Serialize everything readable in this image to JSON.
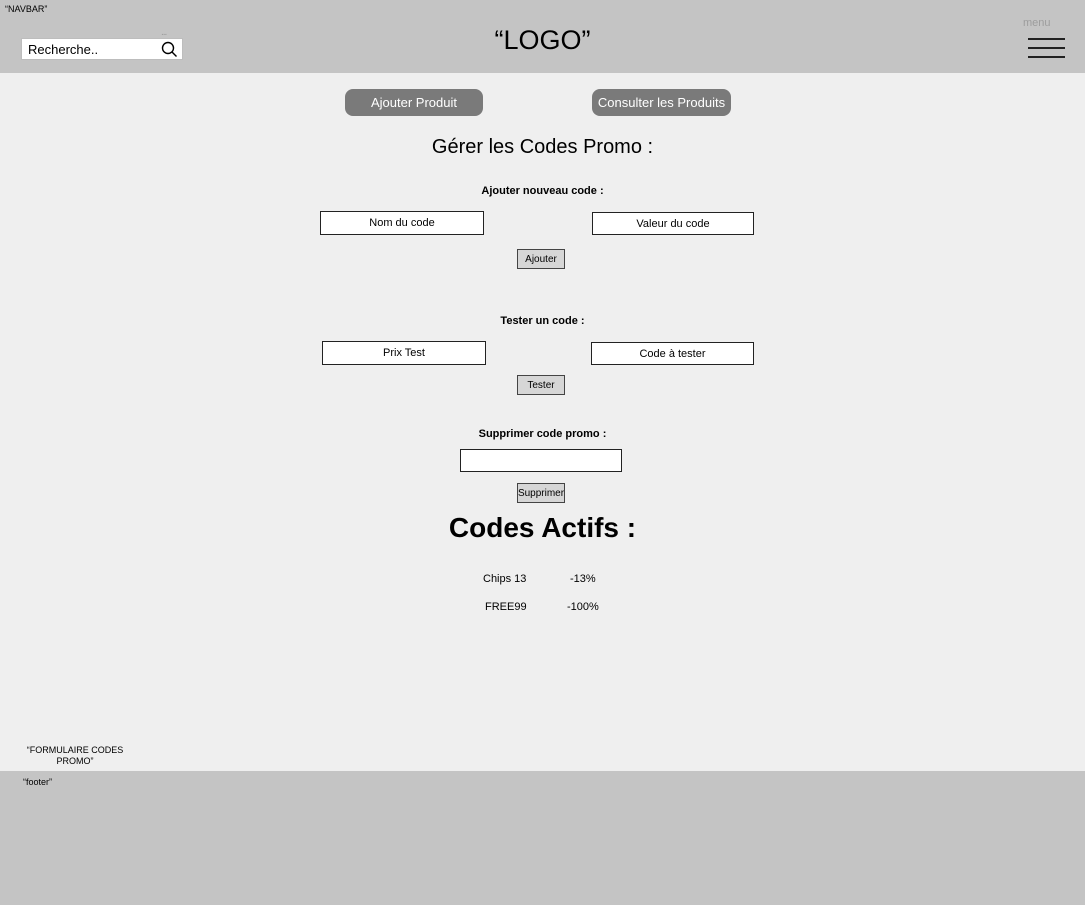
{
  "navbar": {
    "label": "“NAVBAR”",
    "logo": "“LOGO”",
    "menu_label": "menu",
    "search": {
      "placeholder": "Recherche..",
      "icon": "search-icon",
      "dots": "..."
    },
    "menu_icon": "hamburger-icon"
  },
  "actions": {
    "add_product": "Ajouter Produit",
    "view_products": "Consulter les Produits"
  },
  "page_title": "Gérer les Codes Promo :",
  "add_section": {
    "label": "Ajouter nouveau code :",
    "name_field": "Nom du code",
    "value_field": "Valeur du code",
    "button": "Ajouter"
  },
  "test_section": {
    "label": "Tester un code :",
    "price_field": "Prix Test",
    "code_field": "Code à tester",
    "button": "Tester"
  },
  "delete_section": {
    "label": "Supprimer code promo :",
    "field_value": "",
    "button": "Supprimer"
  },
  "active_codes": {
    "title": "Codes Actifs :",
    "rows": [
      {
        "name": "Chips 13",
        "value": "-13%"
      },
      {
        "name": "FREE99",
        "value": "-100%"
      }
    ]
  },
  "form_label": "“FORMULAIRE CODES PROMO”",
  "footer": {
    "label": "“footer”"
  },
  "colors": {
    "navbar_bg": "#c4c4c4",
    "page_bg": "#efefef",
    "pill_button": "#7a7a7a"
  }
}
